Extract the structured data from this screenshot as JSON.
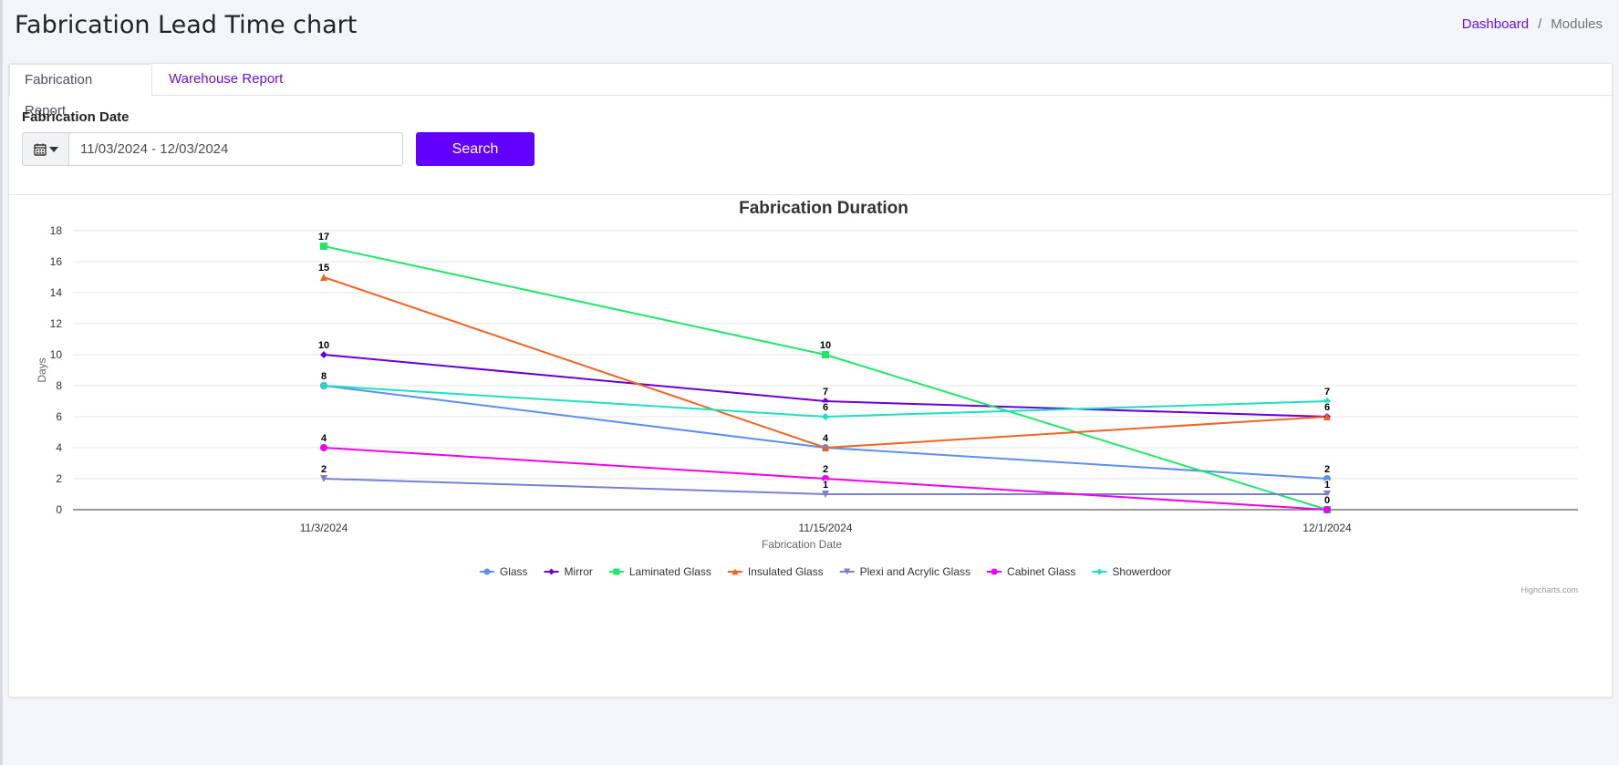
{
  "page": {
    "title": "Fabrication Lead Time chart",
    "breadcrumb": {
      "home": "Dashboard",
      "separator": "/",
      "current": "Modules"
    }
  },
  "tabs": [
    {
      "label": "Fabrication Report",
      "active": true
    },
    {
      "label": "Warehouse Report",
      "active": false
    }
  ],
  "filter": {
    "label": "Fabrication Date",
    "date_range_value": "11/03/2024 - 12/03/2024",
    "calendar_icon": "calendar-icon",
    "search_label": "Search"
  },
  "colors": {
    "accent": "#6200ff",
    "link": "#6610f2"
  },
  "chart_data": {
    "type": "line",
    "title": "Fabrication Duration",
    "xlabel": "Fabrication Date",
    "ylabel": "Days",
    "categories": [
      "11/3/2024",
      "11/15/2024",
      "12/1/2024"
    ],
    "ylim": [
      0,
      18
    ],
    "yticks": [
      0,
      2,
      4,
      6,
      8,
      10,
      12,
      14,
      16,
      18
    ],
    "grid": true,
    "legend": "bottom-center",
    "credits": "Highcharts.com",
    "series": [
      {
        "name": "Glass",
        "values": [
          8,
          4,
          2
        ],
        "color": "#5b8ff0",
        "marker": "circle"
      },
      {
        "name": "Mirror",
        "values": [
          10,
          7,
          6
        ],
        "color": "#6a00d4",
        "marker": "diamond"
      },
      {
        "name": "Laminated Glass",
        "values": [
          17,
          10,
          0
        ],
        "color": "#1ee86a",
        "marker": "square"
      },
      {
        "name": "Insulated Glass",
        "values": [
          15,
          4,
          6
        ],
        "color": "#f26322",
        "marker": "triangle"
      },
      {
        "name": "Plexi and Acrylic Glass",
        "values": [
          2,
          1,
          1
        ],
        "color": "#7a7fd0",
        "marker": "triangle-down"
      },
      {
        "name": "Cabinet Glass",
        "values": [
          4,
          2,
          0
        ],
        "color": "#f000f0",
        "marker": "circle"
      },
      {
        "name": "Showerdoor",
        "values": [
          8,
          6,
          7
        ],
        "color": "#1ee0c0",
        "marker": "diamond"
      }
    ],
    "data_labels": [
      {
        "category": "11/3/2024",
        "value": 17,
        "text": "17"
      },
      {
        "category": "11/3/2024",
        "value": 15,
        "text": "15"
      },
      {
        "category": "11/3/2024",
        "value": 10,
        "text": "10"
      },
      {
        "category": "11/3/2024",
        "value": 8,
        "text": "8"
      },
      {
        "category": "11/3/2024",
        "value": 4,
        "text": "4"
      },
      {
        "category": "11/3/2024",
        "value": 2,
        "text": "2"
      },
      {
        "category": "11/15/2024",
        "value": 10,
        "text": "10"
      },
      {
        "category": "11/15/2024",
        "value": 7,
        "text": "7"
      },
      {
        "category": "11/15/2024",
        "value": 6,
        "text": "6"
      },
      {
        "category": "11/15/2024",
        "value": 4,
        "text": "4"
      },
      {
        "category": "11/15/2024",
        "value": 2,
        "text": "2"
      },
      {
        "category": "11/15/2024",
        "value": 1,
        "text": "1"
      },
      {
        "category": "12/1/2024",
        "value": 7,
        "text": "7"
      },
      {
        "category": "12/1/2024",
        "value": 6,
        "text": "6"
      },
      {
        "category": "12/1/2024",
        "value": 2,
        "text": "2"
      },
      {
        "category": "12/1/2024",
        "value": 1,
        "text": "1"
      },
      {
        "category": "12/1/2024",
        "value": 0,
        "text": "0"
      }
    ]
  }
}
